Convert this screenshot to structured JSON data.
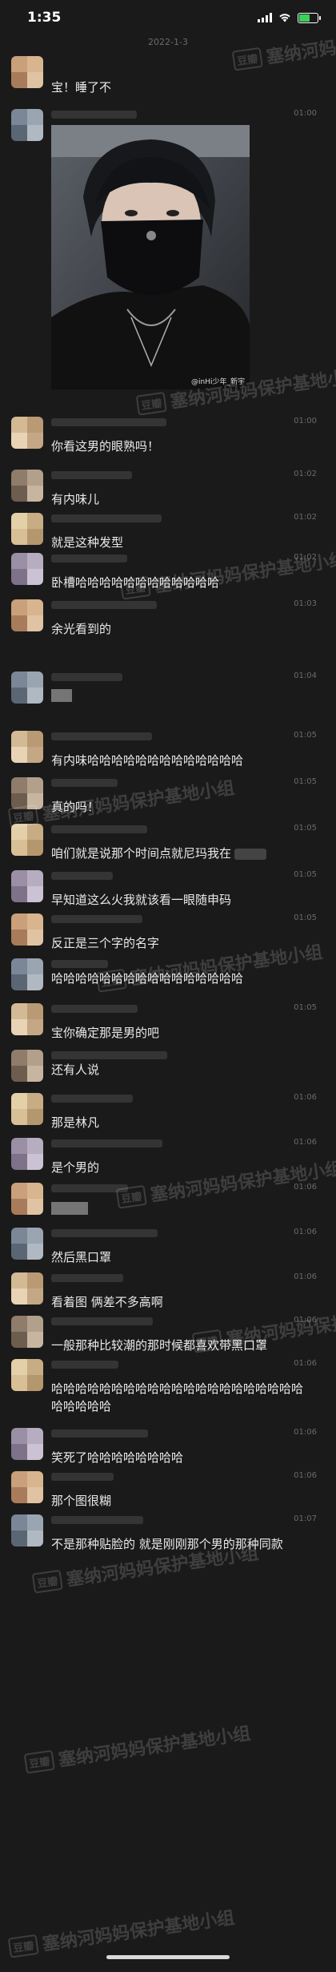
{
  "status": {
    "time": "1:35"
  },
  "date_divider": "2022-1-3",
  "photo_credit": "@inHi少年_新宇",
  "watermark": {
    "logo": "豆瓣",
    "text": "塞纳河妈妈保护基地小组"
  },
  "messages": [
    {
      "time": "",
      "text": "宝！睡了不"
    },
    {
      "time": "01:00",
      "text": ""
    },
    {
      "time": "01:00",
      "text": "你看这男的眼熟吗！"
    },
    {
      "time": "01:02",
      "text": "有内味儿"
    },
    {
      "time": "01:02",
      "text": "就是这种发型"
    },
    {
      "time": "01:02",
      "text": "卧槽哈哈哈哈哈哈哈哈哈哈哈哈"
    },
    {
      "time": "01:03",
      "text": "余光看到的"
    },
    {
      "time": "01:04",
      "text": ""
    },
    {
      "time": "01:05",
      "text": "有内味哈哈哈哈哈哈哈哈哈哈哈哈哈"
    },
    {
      "time": "01:05",
      "text": "真的吗！"
    },
    {
      "time": "01:05",
      "text": "咱们就是说那个时间点就尼玛我在"
    },
    {
      "time": "01:05",
      "text": "早知道这么火我就该看一眼随申码"
    },
    {
      "time": "01:05",
      "text": "反正是三个字的名字"
    },
    {
      "time": "",
      "text": "哈哈哈哈哈哈哈哈哈哈哈哈哈哈哈哈"
    },
    {
      "time": "01:05",
      "text": "宝你确定那是男的吧"
    },
    {
      "time": "",
      "text": "还有人说"
    },
    {
      "time": "01:06",
      "text": "那是林凡"
    },
    {
      "time": "01:06",
      "text": "是个男的"
    },
    {
      "time": "01:06",
      "text": ""
    },
    {
      "time": "01:06",
      "text": "然后黑口罩"
    },
    {
      "time": "01:06",
      "text": "看着图 俩差不多高啊"
    },
    {
      "time": "01:06",
      "text": "一般那种比较潮的那时候都喜欢带黑口罩"
    },
    {
      "time": "01:06",
      "text": "哈哈哈哈哈哈哈哈哈哈哈哈哈哈哈哈哈哈哈哈哈哈哈哈哈哈"
    },
    {
      "time": "01:06",
      "text": "笑死了哈哈哈哈哈哈哈哈"
    },
    {
      "time": "01:06",
      "text": "那个图很糊"
    },
    {
      "time": "01:07",
      "text": "不是那种贴脸的 就是刚刚那个男的那种同款"
    }
  ]
}
